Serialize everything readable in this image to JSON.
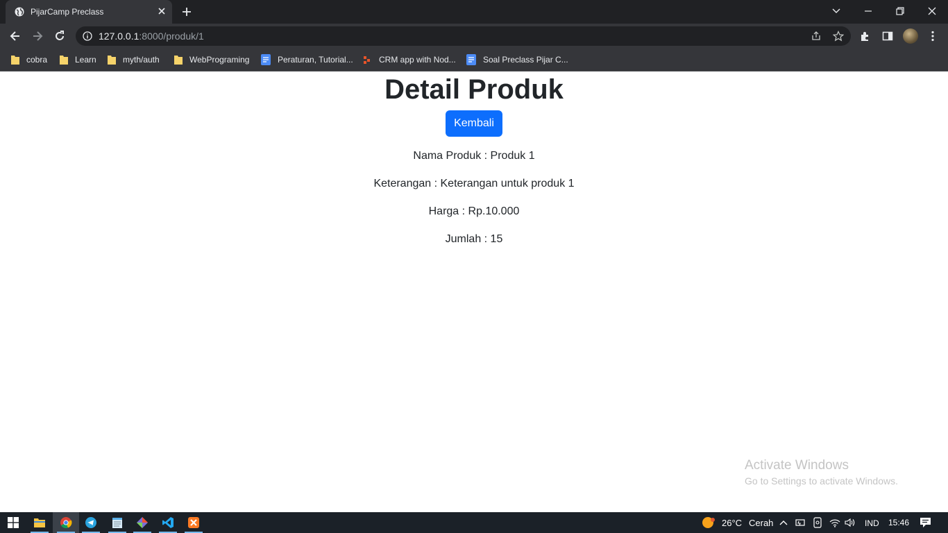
{
  "browser": {
    "tab_title": "PijarCamp Preclass",
    "url_host": "127.0.0.1",
    "url_rest": ":8000/produk/1",
    "bookmarks": [
      {
        "label": "cobra",
        "kind": "folder"
      },
      {
        "label": "Learn",
        "kind": "folder"
      },
      {
        "label": "myth/auth",
        "kind": "folder"
      },
      {
        "label": "WebPrograming",
        "kind": "folder"
      },
      {
        "label": "Peraturan, Tutorial...",
        "kind": "doc"
      },
      {
        "label": "CRM app with Nod...",
        "kind": "site"
      },
      {
        "label": "Soal Preclass Pijar C...",
        "kind": "doc"
      }
    ]
  },
  "page": {
    "heading": "Detail Produk",
    "back_button": "Kembali",
    "lines": {
      "nama": "Nama Produk : Produk 1",
      "keterangan": "Keterangan : Keterangan untuk produk 1",
      "harga": "Harga : Rp.10.000",
      "jumlah": "Jumlah : 15"
    }
  },
  "watermark": {
    "line1": "Activate Windows",
    "line2": "Go to Settings to activate Windows."
  },
  "taskbar": {
    "weather_temp": "26°C",
    "weather_desc": "Cerah",
    "language": "IND",
    "time": "15:46"
  },
  "colors": {
    "accent_button": "#0d6efd",
    "chrome_bg": "#35363a",
    "taskbar_bg": "#1b2128"
  }
}
